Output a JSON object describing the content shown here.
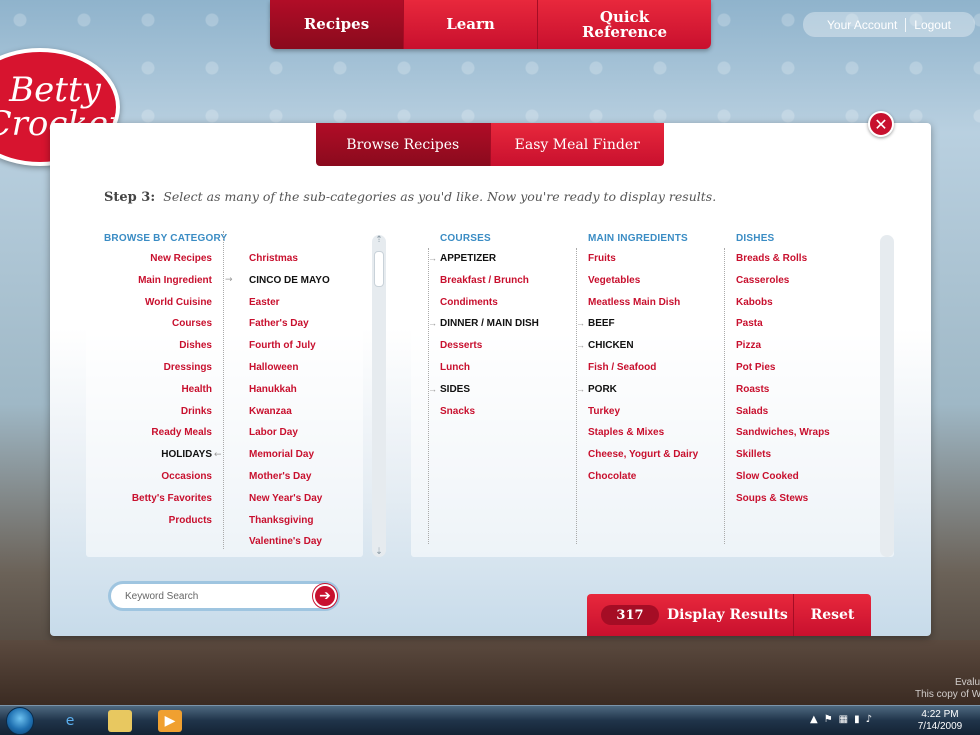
{
  "brand": {
    "logo_line1": "Betty",
    "logo_line2": "Crocker"
  },
  "topnav": {
    "items": [
      "Recipes",
      "Learn",
      "Quick Reference"
    ],
    "active": "Recipes"
  },
  "account": {
    "your_account": "Your Account",
    "logout": "Logout"
  },
  "subtabs": {
    "browse": "Browse Recipes",
    "meal_finder": "Easy Meal Finder",
    "active": "Browse Recipes"
  },
  "step": {
    "label": "Step 3:",
    "text": "Select as many of the sub-categories as you'd like. Now you're ready to display results."
  },
  "browse": {
    "heading": "BROWSE BY CATEGORY",
    "categories": [
      "New Recipes",
      "Main Ingredient",
      "World Cuisine",
      "Courses",
      "Dishes",
      "Dressings",
      "Health",
      "Drinks",
      "Ready Meals",
      "HOLIDAYS",
      "Occasions",
      "Betty's Favorites",
      "Products"
    ],
    "selected_category": "HOLIDAYS",
    "holidays": [
      "Christmas",
      "CINCO DE MAYO",
      "Easter",
      "Father's Day",
      "Fourth of July",
      "Halloween",
      "Hanukkah",
      "Kwanzaa",
      "Labor Day",
      "Memorial Day",
      "Mother's Day",
      "New Year's Day",
      "Thanksgiving",
      "Valentine's Day"
    ],
    "selected_holiday": "CINCO DE MAYO"
  },
  "courses": {
    "heading": "COURSES",
    "items": [
      "APPETIZER",
      "Breakfast / Brunch",
      "Condiments",
      "DINNER / MAIN DISH",
      "Desserts",
      "Lunch",
      "SIDES",
      "Snacks"
    ],
    "selected": [
      "APPETIZER",
      "DINNER / MAIN DISH",
      "SIDES"
    ]
  },
  "main_ingredients": {
    "heading": "MAIN INGREDIENTS",
    "items": [
      "Fruits",
      "Vegetables",
      "Meatless Main Dish",
      "BEEF",
      "CHICKEN",
      "Fish / Seafood",
      "PORK",
      "Turkey",
      "Staples & Mixes",
      "Cheese, Yogurt & Dairy",
      "Chocolate"
    ],
    "selected": [
      "BEEF",
      "CHICKEN",
      "PORK"
    ]
  },
  "dishes": {
    "heading": "DISHES",
    "items": [
      "Breads & Rolls",
      "Casseroles",
      "Kabobs",
      "Pasta",
      "Pizza",
      "Pot Pies",
      "Roasts",
      "Salads",
      "Sandwiches, Wraps",
      "Skillets",
      "Slow Cooked",
      "Soups & Stews"
    ]
  },
  "search": {
    "placeholder": "Keyword Search",
    "go_glyph": "➔"
  },
  "results": {
    "count": "317",
    "display_label": "Display Results",
    "reset_label": "Reset"
  },
  "close_glyph": "✕",
  "taskbar": {
    "time": "4:22 PM",
    "date": "7/14/2009"
  },
  "watermark": {
    "line1": "Evalu",
    "line2": "This copy of W"
  },
  "colors": {
    "brand_red": "#c8102e",
    "dark_red": "#8a0a1d",
    "heading_blue": "#3a8cc4"
  }
}
